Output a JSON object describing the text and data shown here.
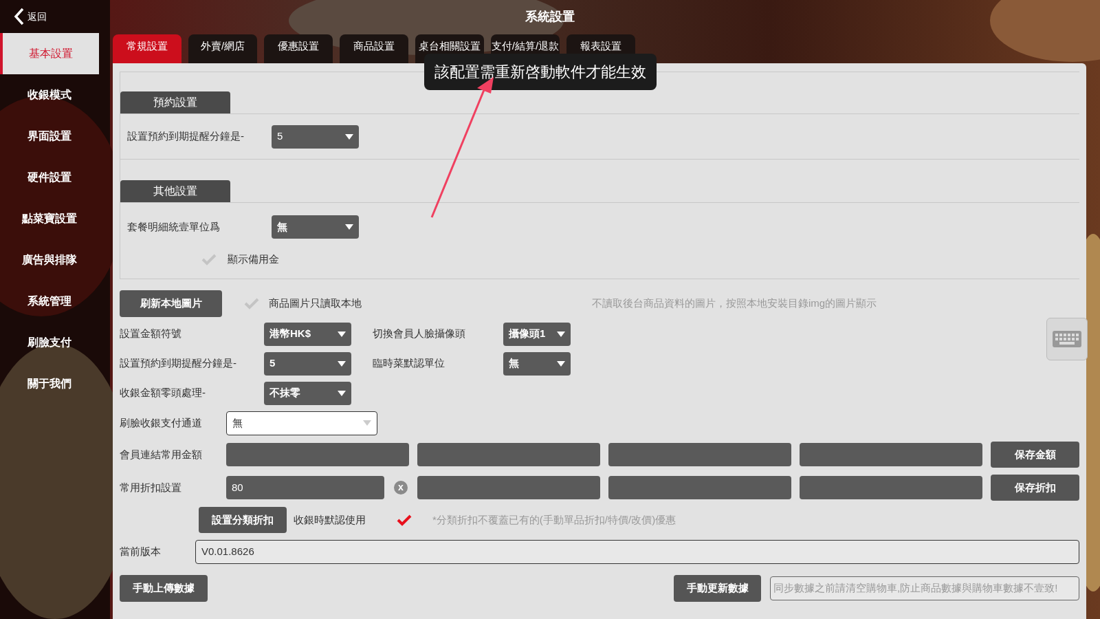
{
  "header": {
    "back_label": "返回",
    "title": "系統設置"
  },
  "sidebar": {
    "items": [
      {
        "label": "基本設置",
        "selected": true
      },
      {
        "label": "收銀模式",
        "selected": false
      },
      {
        "label": "界面設置",
        "selected": false
      },
      {
        "label": "硬件設置",
        "selected": false
      },
      {
        "label": "點菜寶設置",
        "selected": false
      },
      {
        "label": "廣告與排隊",
        "selected": false
      },
      {
        "label": "系統管理",
        "selected": false
      },
      {
        "label": "刷臉支付",
        "selected": false
      },
      {
        "label": "關于我們",
        "selected": false
      }
    ]
  },
  "tabs": [
    {
      "label": "常規設置",
      "selected": true
    },
    {
      "label": "外賣/網店",
      "selected": false
    },
    {
      "label": "優惠設置",
      "selected": false
    },
    {
      "label": "商品設置",
      "selected": false
    },
    {
      "label": "桌台相關設置",
      "selected": false
    },
    {
      "label": "支付/結算/退款",
      "selected": false
    },
    {
      "label": "報表設置",
      "selected": false
    }
  ],
  "tooltip": "該配置需重新啓動軟件才能生效",
  "booking_section": {
    "title": "預約設置",
    "label": "設置預約到期提醒分鐘是-",
    "value": "5"
  },
  "other_section": {
    "title": "其他設置",
    "label": "套餐明細統壹單位爲",
    "value": "無",
    "checkbox": {
      "label": "顯示備用金",
      "checked": false
    }
  },
  "refresh": {
    "button": "刷新本地圖片",
    "checkbox": {
      "label": "商品圖片只讀取本地",
      "checked": false
    },
    "hint": "不讀取後台商品資料的圖片，按照本地安裝目錄img的圖片顯示"
  },
  "dropdown_rows": [
    {
      "label": "設置金額符號",
      "value": "港幣HK$",
      "extra": {
        "label": "切換會員人臉攝像頭",
        "value": "攝像頭1"
      }
    },
    {
      "label": "設置預約到期提醒分鐘是-",
      "value": "5",
      "extra": {
        "label": "臨時菜默認單位",
        "value": "無"
      }
    },
    {
      "label": "收銀金額零頭處理-",
      "value": "不抹零"
    }
  ],
  "face_pay": {
    "label": "刷臉收銀支付通道",
    "value": "無"
  },
  "member_amounts": {
    "label": "會員連結常用金額",
    "button": "保存金額"
  },
  "discounts": {
    "label": "常用折扣設置",
    "first_value": "80",
    "clear": "x",
    "button": "保存折扣"
  },
  "category_discount": {
    "button": "設置分類折扣",
    "label": "收銀時默認使用",
    "checked": true,
    "note": "*分類折扣不覆蓋已有的(手動單品折扣/特價/改價)優惠"
  },
  "version": {
    "label": "當前版本",
    "value": "V0.01.8626"
  },
  "footer": {
    "upload_button": "手動上傳數據",
    "update_button": "手動更新數據",
    "notice": "同步數據之前請清空購物車,防止商品數據與購物車數據不壹致!"
  }
}
